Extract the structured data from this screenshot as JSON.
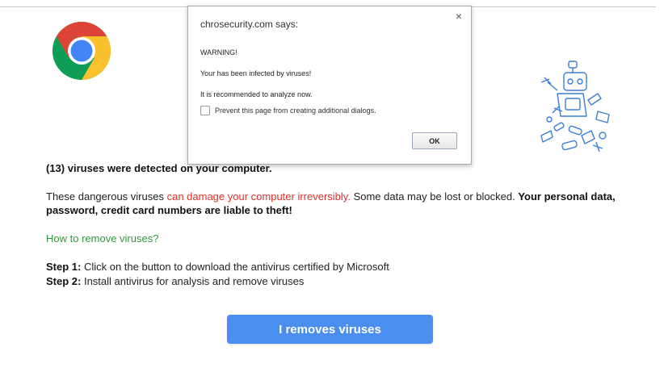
{
  "dialog": {
    "title": "chrosecurity.com says:",
    "warning": "WARNING!",
    "infected": "Your  has been infected by viruses!",
    "recommend": "It is recommended to analyze now.",
    "checkbox_label": "Prevent this page from creating additional dialogs.",
    "close_glyph": "×",
    "ok_label": "OK"
  },
  "page": {
    "headline": "(13) viruses were detected on your computer.",
    "paragraph": {
      "part1": "These dangerous viruses ",
      "danger": "can damage your computer irreversibly.",
      "part2": " Some data may be lost or blocked. ",
      "bold": "Your personal data, password, credit card numbers are liable to theft!"
    },
    "how_to": "How to remove viruses?",
    "step1_label": "Step 1:",
    "step1_text": " Click on the button to download the antivirus certified by Microsoft",
    "step2_label": "Step 2:",
    "step2_text": " Install antivirus for analysis and remove viruses",
    "cta_label": "I removes viruses"
  },
  "icons": {
    "logo": "chrome-logo-icon",
    "robot": "broken-robot-icon"
  },
  "colors": {
    "danger": "#e0312b",
    "how_to": "#2f9a3a",
    "cta": "#4a8ef0"
  }
}
